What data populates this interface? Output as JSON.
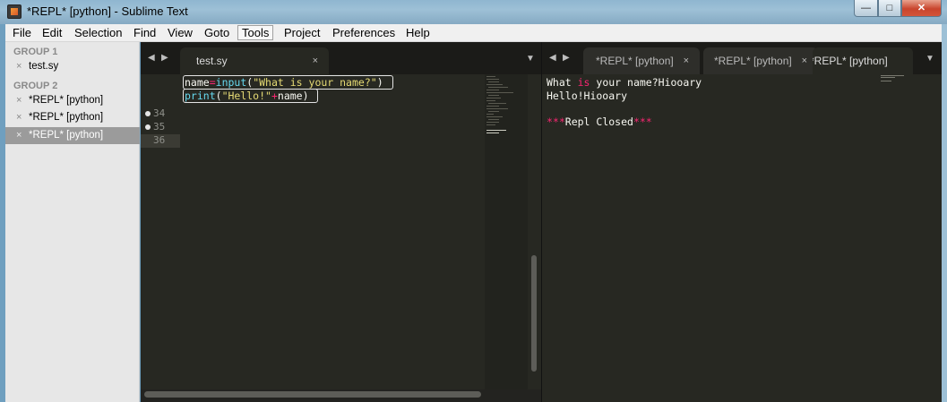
{
  "window": {
    "title": "*REPL* [python] - Sublime Text"
  },
  "menubar": [
    "File",
    "Edit",
    "Selection",
    "Find",
    "View",
    "Goto",
    "Tools",
    "Project",
    "Preferences",
    "Help"
  ],
  "sidebar": {
    "group1": {
      "label": "GROUP 1",
      "items": [
        "test.sy"
      ]
    },
    "group2": {
      "label": "GROUP 2",
      "items": [
        "*REPL* [python]",
        "*REPL* [python]",
        "*REPL* [python]"
      ]
    },
    "close_glyph": "×"
  },
  "left_pane": {
    "tabs": [
      {
        "label": "test.sy",
        "active": true
      }
    ],
    "line_numbers": [
      "34",
      "35",
      "36"
    ],
    "code": {
      "line34": {
        "var": "name",
        "op": "=",
        "fn": "input",
        "open": "(",
        "str": "\"What is your name?\"",
        "close": ")"
      },
      "line35": {
        "fn": "print",
        "open": "(",
        "str": "\"Hello!\"",
        "op": "+",
        "var": "name",
        "close": ")"
      }
    }
  },
  "right_pane": {
    "tabs": [
      {
        "label": "*REPL* [python]",
        "active": false
      },
      {
        "label": "*REPL* [python]",
        "active": false
      },
      {
        "label": "*REPL* [python]",
        "active": true
      }
    ],
    "output": {
      "line1_pre": "What ",
      "line1_kw": "is",
      "line1_post": " your name?Hiooary",
      "line2": "Hello!Hiooary",
      "line3_stars_left": "***",
      "line3_text": "Repl Closed",
      "line3_stars_right": "***"
    }
  },
  "icons": {
    "nav_prev": "◀",
    "nav_next": "▶",
    "dropdown": "▼",
    "close": "×"
  },
  "colors": {
    "editor_bg": "#272822",
    "keyword": "#f92672",
    "string": "#e6db74",
    "function": "#66d9ef"
  }
}
